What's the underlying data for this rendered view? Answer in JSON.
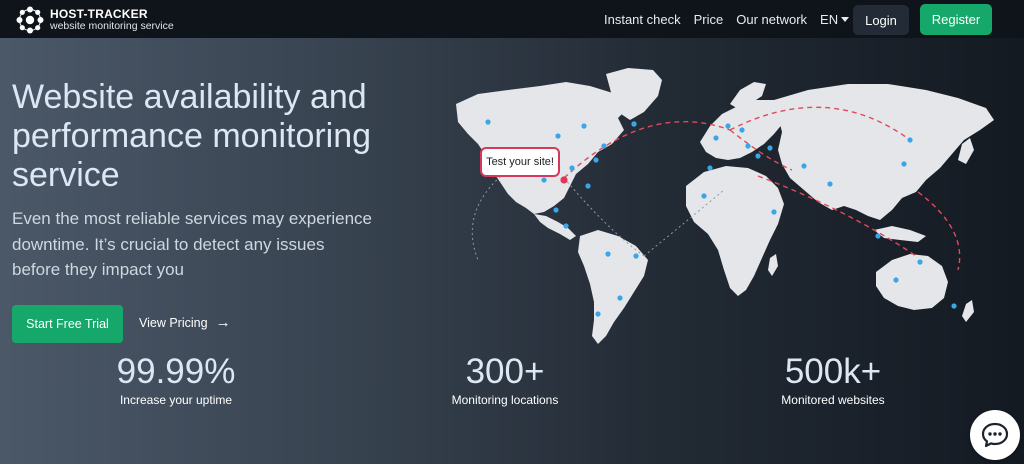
{
  "brand": {
    "title": "HOST-TRACKER",
    "subtitle": "website monitoring service"
  },
  "nav": {
    "links": [
      "Instant check",
      "Price",
      "Our network"
    ],
    "language": "EN",
    "login": "Login",
    "register": "Register"
  },
  "hero": {
    "title": "Website availability and performance monitoring service",
    "description": "Even the most reliable services may experience downtime. It’s crucial to detect any issues before they impact you",
    "primary_cta": "Start Free Trial",
    "secondary_cta": "View Pricing"
  },
  "map": {
    "tooltip": "Test your site!"
  },
  "stats": [
    {
      "value": "99.99%",
      "label": "Increase your uptime"
    },
    {
      "value": "300+",
      "label": "Monitoring locations"
    },
    {
      "value": "500k+",
      "label": "Monitored websites"
    }
  ],
  "colors": {
    "accent_green": "#16a86b",
    "nav_bg": "#0f141b",
    "tooltip_border": "#d6385b",
    "map_land": "#e4e6e9",
    "map_dot": "#3aa6e8",
    "route_line": "#e04a5a"
  },
  "icons": {
    "logo": "globe-network-icon",
    "arrow": "arrow-right-icon",
    "chat": "chat-bubble-icon",
    "language": "caret-down-icon"
  }
}
